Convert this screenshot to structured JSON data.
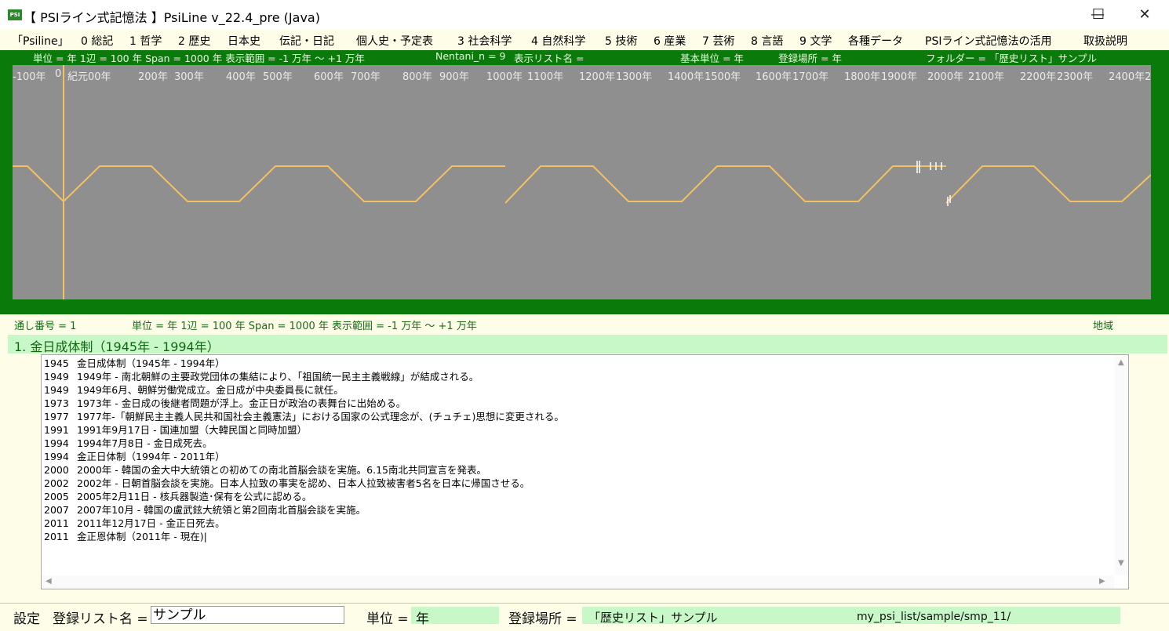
{
  "window": {
    "icon_text": "PSI",
    "title": "【 PSIライン式記憶法 】PsiLine v_22.4_pre (Java)",
    "minimize_glyph": "—",
    "maximize_glyph": "☐",
    "close_glyph": "✕"
  },
  "menu": [
    "「Psiline」",
    "0 総記",
    "1 哲学",
    "2 歴史",
    "日本史",
    "伝記・日記",
    "個人史・予定表",
    "3 社会科学",
    "4 自然科学",
    "5 技術",
    "6 産業",
    "7 芸術",
    "8 言語",
    "9 文学",
    "各種データ",
    "PSIライン式記憶法の活用",
    "取扱説明"
  ],
  "timeline_header": {
    "unit": "単位 = 年 1辺 = 100 年 Span = 1000 年 表示範囲 = -1 万年 ～ +1 万年",
    "nentani": "Nentani_n = 9",
    "list_name": "表示リスト名 =",
    "base_unit": "基本単位 = 年",
    "reg_place": "登録場所 = 年",
    "folder": "フォルダー = 「歴史リスト」サンプル"
  },
  "ticks": [
    "-100年",
    "0",
    "紀元00年",
    "200年",
    "300年",
    "400年",
    "500年",
    "600年",
    "700年",
    "800年",
    "900年",
    "1000年",
    "1100年",
    "1200年",
    "1300年",
    "1400年",
    "1500年",
    "1600年",
    "1700年",
    "1800年",
    "1900年",
    "2000年",
    "2100年",
    "2200年",
    "2300年",
    "2400年2"
  ],
  "status_line": {
    "serial": "通し番号 = 1",
    "unit_info": "単位 = 年 1辺 = 100 年 Span = 1000 年 表示範囲 = -1 万年 ～ +1 万年",
    "region": "地域"
  },
  "record_title": "1. 金日成体制（1945年 - 1994年）",
  "entries": [
    {
      "year": "1945",
      "text": "金日成体制（1945年 - 1994年）"
    },
    {
      "year": "1949",
      "text": "1949年 - 南北朝鮮の主要政党団体の集結により、「祖国統一民主主義戦線」が結成される。"
    },
    {
      "year": "1949",
      "text": "1949年6月、朝鮮労働党成立。金日成が中央委員長に就任。"
    },
    {
      "year": "1973",
      "text": "1973年 - 金日成の後継者問題が浮上。金正日が政治の表舞台に出始める。"
    },
    {
      "year": "1977",
      "text": "1977年-「朝鮮民主主義人民共和国社会主義憲法」における国家の公式理念が、(チュチェ)思想に変更される。"
    },
    {
      "year": "1991",
      "text": "1991年9月17日 - 国連加盟（大韓民国と同時加盟）"
    },
    {
      "year": "1994",
      "text": "1994年7月8日 - 金日成死去。"
    },
    {
      "year": "1994",
      "text": "金正日体制（1994年 - 2011年）"
    },
    {
      "year": "2000",
      "text": "2000年 - 韓国の金大中大統領との初めての南北首脳会談を実施。6.15南北共同宣言を発表。"
    },
    {
      "year": "2002",
      "text": "2002年 - 日朝首脳会談を実施。日本人拉致の事実を認め、日本人拉致被害者5名を日本に帰国させる。"
    },
    {
      "year": "2005",
      "text": "2005年2月11日 - 核兵器製造･保有を公式に認める。"
    },
    {
      "year": "2007",
      "text": "2007年10月 - 韓国の盧武鉉大統領と第2回南北首脳会談を実施。"
    },
    {
      "year": "2011",
      "text": "2011年12月17日 - 金正日死去。"
    },
    {
      "year": "2011",
      "text": "金正恩体制（2011年 - 現在)|"
    }
  ],
  "bottom": {
    "settings": "設定",
    "list_label": "登録リスト名 =",
    "list_value": "サンプル",
    "unit_label": "単位 =",
    "unit_value": "年",
    "place_label": "登録場所 =",
    "place_value": "「歴史リスト」サンプル",
    "path_value": "my_psi_list/sample/smp_11/"
  },
  "colors": {
    "frame_green": "#0a7a0a",
    "canvas_gray": "#8f8f8f",
    "line_yellow": "#f5c060",
    "highlight_green": "#c8f8c8",
    "background": "#fdfde8"
  }
}
